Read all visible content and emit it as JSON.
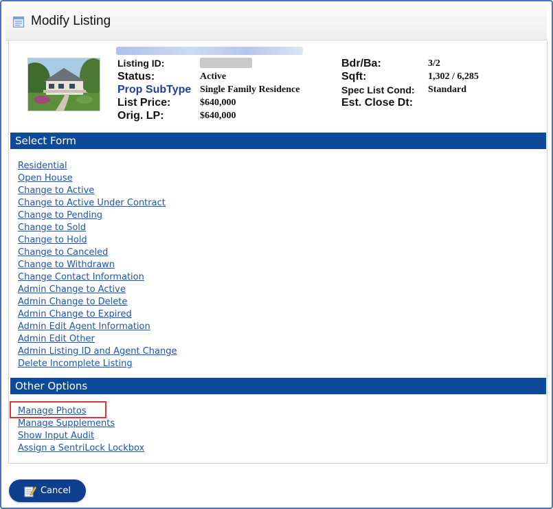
{
  "window": {
    "title": "Modify Listing",
    "icon": "form-icon"
  },
  "listing": {
    "left": [
      {
        "label": "Listing ID:",
        "value": ""
      },
      {
        "label": "Status:",
        "value": "Active"
      },
      {
        "label": "Prop SubType",
        "value": "Single Family Residence"
      },
      {
        "label": "List Price:",
        "value": "$640,000"
      },
      {
        "label": "Orig. LP:",
        "value": "$640,000"
      }
    ],
    "right": [
      {
        "label": "Bdr/Ba:",
        "value": "3/2"
      },
      {
        "label": "Sqft:",
        "value": "1,302 / 6,285"
      },
      {
        "label": "Spec List Cond:",
        "value": "Standard"
      },
      {
        "label": "Est. Close Dt:",
        "value": ""
      }
    ]
  },
  "select_form": {
    "title": "Select Form",
    "links": [
      "Residential",
      "Open House",
      "Change to Active",
      "Change to Active Under Contract",
      "Change to Pending",
      "Change to Sold",
      "Change to Hold",
      "Change to Canceled",
      "Change to Withdrawn",
      "Change Contact Information",
      "Admin Change to Active",
      "Admin Change to Delete",
      "Admin Change to Expired",
      "Admin Edit Agent Information",
      "Admin Edit Other",
      "Admin Listing ID and Agent Change",
      "Delete Incomplete Listing"
    ]
  },
  "other_options": {
    "title": "Other Options",
    "links": [
      "Manage Photos",
      "Manage Supplements",
      "Show Input Audit",
      "Assign a SentriLock Lockbox"
    ]
  },
  "footer": {
    "cancel_label": "Cancel",
    "cancel_icon": "edit-cancel-icon"
  },
  "colors": {
    "accent": "#0e4a9a",
    "link": "#1a55b8",
    "highlight": "#e0323a",
    "label_blue": "#1f3f9e"
  }
}
